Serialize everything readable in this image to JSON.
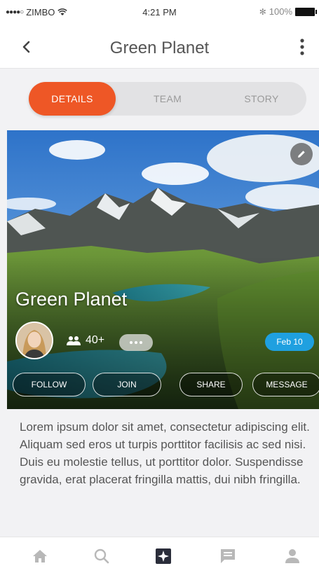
{
  "status_bar": {
    "carrier": "ZIMBO",
    "signal": "●●●●○",
    "time": "4:21 PM",
    "battery": "100%"
  },
  "nav": {
    "title": "Green Planet",
    "back_icon": "chevron-left-icon",
    "more_icon": "vertical-ellipsis-icon"
  },
  "segments": {
    "items": [
      "DETAILS",
      "TEAM",
      "STORY"
    ],
    "active": "DETAILS",
    "accent": "#ee5726"
  },
  "hero": {
    "title": "Green Planet",
    "member_count": "40+",
    "date_badge": "Feb 10",
    "actions": [
      "FOLLOW",
      "JOIN",
      "SHARE",
      "MESSAGE"
    ],
    "badge_color": "#1fa0e0"
  },
  "description": "Lorem ipsum dolor sit amet, consectetur adipiscing elit. Aliquam sed eros ut turpis porttitor facilisis ac sed nisi. Duis eu molestie tellus, ut porttitor dolor. Suspendisse gravida, erat placerat fringilla mattis, dui nibh fringilla.",
  "tab_bar": {
    "items": [
      "home-icon",
      "search-icon",
      "featured-icon",
      "chat-icon",
      "profile-icon"
    ],
    "active": "featured-icon"
  }
}
